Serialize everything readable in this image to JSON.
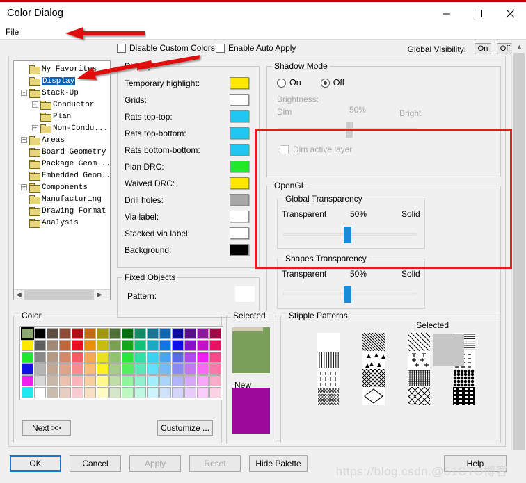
{
  "window": {
    "title": "Color Dialog",
    "minimize_icon": "minimize-icon",
    "maximize_icon": "maximize-icon",
    "close_icon": "close-icon"
  },
  "menubar": {
    "items": [
      {
        "label": "File"
      }
    ]
  },
  "top_options": {
    "disable_custom_colors": "Disable Custom Colors",
    "enable_auto_apply": "Enable Auto Apply",
    "global_visibility_label": "Global Visibility:",
    "global_visibility_on": "On",
    "global_visibility_off": "Off"
  },
  "tree": {
    "items": [
      {
        "label": "My Favorites",
        "indent": 0,
        "expander": "",
        "selected": false
      },
      {
        "label": "Display",
        "indent": 0,
        "expander": "",
        "selected": true
      },
      {
        "label": "Stack-Up",
        "indent": 0,
        "expander": "-",
        "selected": false
      },
      {
        "label": "Conductor",
        "indent": 1,
        "expander": "+",
        "selected": false
      },
      {
        "label": "Plan",
        "indent": 1,
        "expander": "",
        "selected": false
      },
      {
        "label": "Non-Condu...",
        "indent": 1,
        "expander": "+",
        "selected": false
      },
      {
        "label": "Areas",
        "indent": 0,
        "expander": "+",
        "selected": false
      },
      {
        "label": "Board Geometry",
        "indent": 0,
        "expander": "",
        "selected": false
      },
      {
        "label": "Package Geom...",
        "indent": 0,
        "expander": "",
        "selected": false
      },
      {
        "label": "Embedded Geom...",
        "indent": 0,
        "expander": "",
        "selected": false
      },
      {
        "label": "Components",
        "indent": 0,
        "expander": "+",
        "selected": false
      },
      {
        "label": "Manufacturing",
        "indent": 0,
        "expander": "",
        "selected": false
      },
      {
        "label": "Drawing Format",
        "indent": 0,
        "expander": "",
        "selected": false
      },
      {
        "label": "Analysis",
        "indent": 0,
        "expander": "",
        "selected": false
      }
    ]
  },
  "display_group": {
    "legend": "Display",
    "rows": [
      {
        "label": "Temporary highlight:",
        "color": "#ffe800"
      },
      {
        "label": "Grids:",
        "color": "#ffffff"
      },
      {
        "label": "Rats top-top:",
        "color": "#1fc8f0"
      },
      {
        "label": "Rats top-bottom:",
        "color": "#1fc8f0"
      },
      {
        "label": "Rats bottom-bottom:",
        "color": "#1fc8f0"
      },
      {
        "label": "Plan DRC:",
        "color": "#20e82a"
      },
      {
        "label": "Waived DRC:",
        "color": "#ffe800"
      },
      {
        "label": "Drill holes:",
        "color": "#a8a8a8"
      },
      {
        "label": "Via label:",
        "color": "#ffffff"
      },
      {
        "label": "Stacked via label:",
        "color": "#ffffff"
      },
      {
        "label": "Background:",
        "color": "#000000"
      }
    ]
  },
  "fixed_objects": {
    "legend": "Fixed Objects",
    "pattern_label": "Pattern:",
    "pattern_color": "#ffffff"
  },
  "shadow_mode": {
    "legend": "Shadow Mode",
    "on_label": "On",
    "off_label": "Off",
    "selected": "Off",
    "brightness_label": "Brightness:",
    "dim_label": "Dim",
    "percent": "50%",
    "bright_label": "Bright",
    "dim_active_layer": "Dim active layer",
    "dim_active_checked": false
  },
  "opengl": {
    "legend": "OpenGL",
    "global_transparency": {
      "legend": "Global Transparency",
      "transparent_label": "Transparent",
      "percent": "50%",
      "solid_label": "Solid",
      "value": 50
    },
    "shapes_transparency": {
      "legend": "Shapes Transparency",
      "transparent_label": "Transparent",
      "percent": "50%",
      "solid_label": "Solid",
      "value": 50
    }
  },
  "color_group": {
    "legend": "Color",
    "next_label": "Next >>",
    "customize_label": "Customize ...",
    "selected_index": 0,
    "palette": [
      "#8ba870",
      "#000000",
      "#5e4f45",
      "#8a4a36",
      "#b01016",
      "#c06a10",
      "#a09510",
      "#4e7038",
      "#007010",
      "#108a62",
      "#1a7390",
      "#0f66ae",
      "#0b0ba0",
      "#5c108a",
      "#8a1c9c",
      "#9c0d48",
      "#ffe800",
      "#5e5e5e",
      "#a08a76",
      "#c0663a",
      "#ea1020",
      "#ee8c10",
      "#c8bc10",
      "#7aa050",
      "#12a818",
      "#12c078",
      "#1aa8c4",
      "#1276e0",
      "#1010e8",
      "#8a10c8",
      "#c010c8",
      "#e81060",
      "#20e82a",
      "#8a8a8a",
      "#b49a84",
      "#d4886a",
      "#f85a64",
      "#f8a850",
      "#e8e020",
      "#8ec470",
      "#2ae83a",
      "#30e0a4",
      "#3ad2ee",
      "#4aa4f0",
      "#5a6ae8",
      "#b04af0",
      "#f020f0",
      "#f84a8a",
      "#1010e8",
      "#b4b4b4",
      "#c0a894",
      "#e0a48a",
      "#f88a90",
      "#f8bc74",
      "#fff020",
      "#a8cc8a",
      "#50f060",
      "#5ce8b8",
      "#64e0f8",
      "#78baf4",
      "#8a8af0",
      "#c478f4",
      "#f86af4",
      "#f87aa8",
      "#f020f0",
      "#d8d8d8",
      "#c8b8a8",
      "#eec0ae",
      "#f8b4b8",
      "#f8d0a0",
      "#fff890",
      "#c0dca8",
      "#90f49c",
      "#96f0d0",
      "#a4ecfa",
      "#a8d4f8",
      "#b4b4f8",
      "#d8a8f8",
      "#f8a8f8",
      "#f8aec8",
      "#20e8f0",
      "#ffffff",
      "#c8bcae",
      "#e8cec0",
      "#f8ccd0",
      "#f8e0c4",
      "#fffcc4",
      "#d4e8c8",
      "#bcf8c0",
      "#c0f8e4",
      "#cdf4fc",
      "#cde4fc",
      "#d4d4fc",
      "#e8ccfc",
      "#fccdfc",
      "#fcd2e4"
    ]
  },
  "selected_panel": {
    "selected_legend": "Selected",
    "selected_color": "#7ba05b",
    "new_legend": "New",
    "new_color": "#9b0a9b"
  },
  "stipple": {
    "legend": "Stipple Patterns",
    "selected_legend": "Selected",
    "selected_color": "#c6c6c6",
    "patterns": [
      "solid-blank-pattern",
      "diagonal-lines-up-pattern",
      "diagonal-lines-wide-pattern",
      "horizontal-lines-pattern",
      "vertical-lines-pattern",
      "triangles-pattern",
      "plus-tee-pattern",
      "dashes-pattern",
      "short-vertical-dashes-pattern",
      "diagonal-crosshatch-pattern",
      "grid-pattern",
      "dense-dots-diamond-pattern",
      "circles-pattern",
      "diamond-outline-pattern",
      "x-cross-pattern",
      "dense-checker-pattern"
    ]
  },
  "buttons": {
    "ok": "OK",
    "cancel": "Cancel",
    "apply": "Apply",
    "reset": "Reset",
    "hide_palette": "Hide Palette",
    "help": "Help"
  },
  "watermark": "https://blog.csdn.@51CTO博客"
}
